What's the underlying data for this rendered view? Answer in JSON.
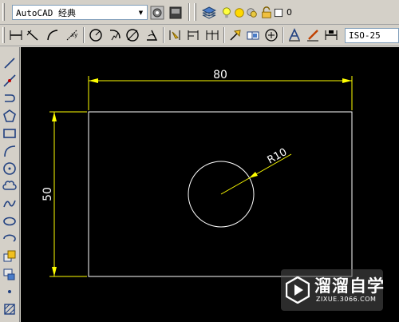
{
  "workspace": {
    "selected": "AutoCAD 经典"
  },
  "layer": {
    "current": "0"
  },
  "dimstyle": {
    "current": "ISO-25"
  },
  "drawing": {
    "rectangle": {
      "width": 80,
      "height": 50
    },
    "circle": {
      "radius": 10
    },
    "dimensions": {
      "horizontal": "80",
      "vertical": "50",
      "radius": "R10"
    }
  },
  "watermark": {
    "main": "溜溜自学",
    "sub": "ZIXUE.3066.COM"
  },
  "colors": {
    "canvas": "#000000",
    "dimension": "#ffff00",
    "geometry": "#ffffff",
    "toolbar": "#d4d0c8"
  }
}
